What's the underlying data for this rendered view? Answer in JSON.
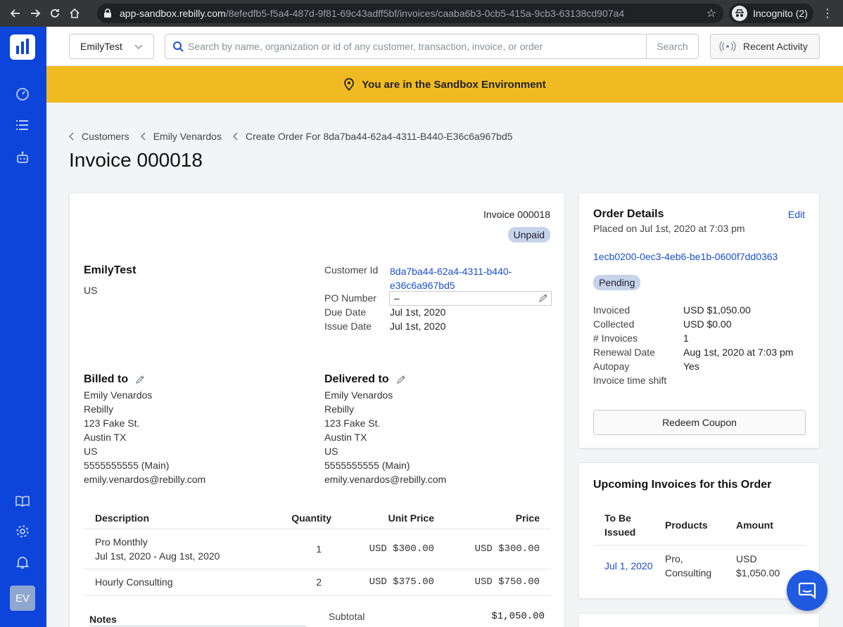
{
  "browser": {
    "url_host": "app-sandbox.rebilly.com",
    "url_path": "/8efedfb5-f5a4-487d-9f81-69c43adff5bf/invoices/caaba6b3-0cb5-415a-9cb3-63138cd907a4",
    "incognito_label": "Incognito (2)"
  },
  "topbar": {
    "org_name": "EmilyTest",
    "search_placeholder": "Search by name, organization or id of any customer, transaction, invoice, or order",
    "search_button": "Search",
    "recent_activity": "Recent Activity"
  },
  "banner": {
    "text": "You are in the Sandbox Environment"
  },
  "breadcrumbs": [
    "Customers",
    "Emily Venardos",
    "Create Order For 8da7ba44-62a4-4311-B440-E36c6a967bd5"
  ],
  "page_title": "Invoice 000018",
  "invoice": {
    "number": "Invoice 000018",
    "status": "Unpaid",
    "customer_name": "EmilyTest",
    "customer_country": "US",
    "meta": {
      "customer_id_label": "Customer Id",
      "customer_id_line1": "8da7ba44-62a4-4311-b440-",
      "customer_id_line2": "e36c6a967bd5",
      "po_label": "PO Number",
      "po_value": "–",
      "due_label": "Due Date",
      "due_value": "Jul 1st, 2020",
      "issue_label": "Issue Date",
      "issue_value": "Jul 1st, 2020"
    },
    "billed_to": {
      "heading": "Billed to",
      "lines": [
        "Emily Venardos",
        "Rebilly",
        "123 Fake St.",
        "Austin TX",
        "US",
        "5555555555 (Main)",
        "emily.venardos@rebilly.com"
      ]
    },
    "delivered_to": {
      "heading": "Delivered to",
      "lines": [
        "Emily Venardos",
        "Rebilly",
        "123 Fake St.",
        "Austin TX",
        "US",
        "5555555555 (Main)",
        "emily.venardos@rebilly.com"
      ]
    },
    "table": {
      "headers": {
        "description": "Description",
        "quantity": "Quantity",
        "unit_price": "Unit Price",
        "price": "Price"
      },
      "rows": [
        {
          "description": "Pro Monthly",
          "period": "Jul 1st, 2020 - Aug 1st, 2020",
          "quantity": "1",
          "unit_price": "USD $300.00",
          "price": "USD $300.00"
        },
        {
          "description": "Hourly Consulting",
          "period": "",
          "quantity": "2",
          "unit_price": "USD $375.00",
          "price": "USD $750.00"
        }
      ]
    },
    "notes_label": "Notes",
    "subtotal_label": "Subtotal",
    "subtotal_value": "$1,050.00"
  },
  "order": {
    "heading": "Order Details",
    "edit": "Edit",
    "placed": "Placed on Jul 1st, 2020 at 7:03 pm",
    "id": "1ecb0200-0ec3-4eb6-be1b-0600f7dd0363",
    "status": "Pending",
    "rows": [
      {
        "label": "Invoiced",
        "value": "USD $1,050.00"
      },
      {
        "label": "Collected",
        "value": "USD $0.00"
      },
      {
        "label": "# Invoices",
        "value": "1"
      },
      {
        "label": "Renewal Date",
        "value": "Aug 1st, 2020 at 7:03 pm"
      },
      {
        "label": "Autopay",
        "value": "Yes"
      },
      {
        "label": "Invoice time shift",
        "value": ""
      }
    ],
    "coupon_button": "Redeem Coupon"
  },
  "upcoming": {
    "heading": "Upcoming Invoices for this Order",
    "headers": {
      "issued_line1": "To Be",
      "issued_line2": "Issued",
      "products": "Products",
      "amount": "Amount"
    },
    "rows": [
      {
        "date": "Jul 1, 2020",
        "products_line1": "Pro,",
        "products_line2": "Consulting",
        "amount_line1": "USD",
        "amount_line2": "$1,050.00"
      }
    ]
  },
  "user": {
    "initials": "EV"
  },
  "colors": {
    "rail": "#0d44d9",
    "banner": "#f0bb22",
    "link": "#1a4fcf",
    "badge": "#c6d3ea"
  }
}
